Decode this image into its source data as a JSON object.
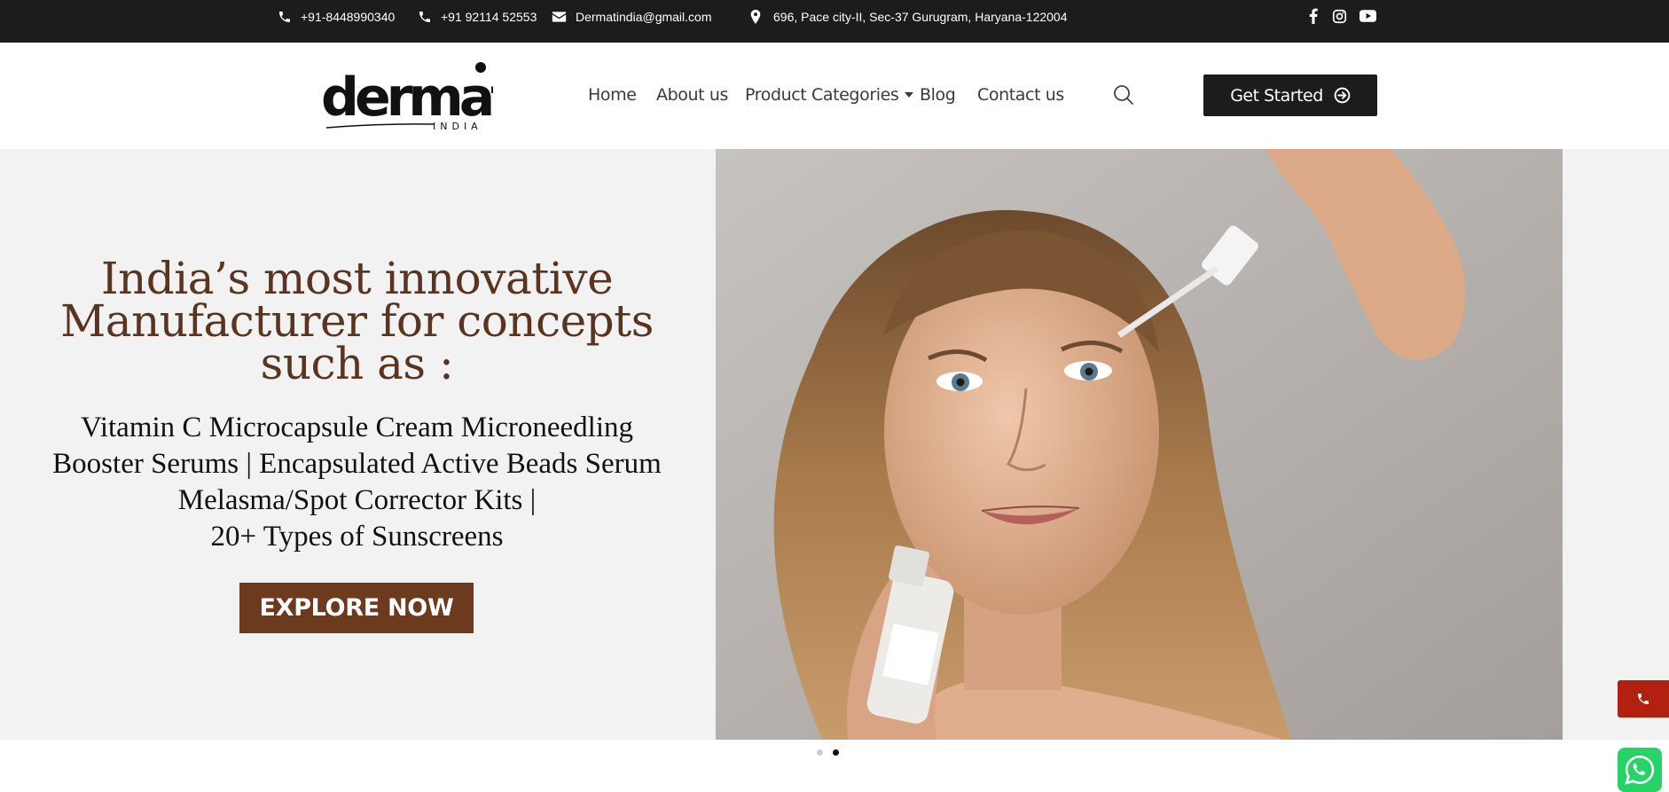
{
  "topbar": {
    "phone1": "+91-8448990340",
    "phone2": "+91 92114 52553",
    "email": "Dermatindia@gmail.com",
    "address": "696, Pace city-II, Sec-37 Gurugram, Haryana-122004",
    "social": [
      "facebook-icon",
      "instagram-icon",
      "youtube-icon"
    ]
  },
  "header": {
    "logo_word": "dermat",
    "logo_sub": "INDIA",
    "nav": {
      "home": "Home",
      "about": "About us",
      "categories": "Product Categories",
      "blog": "Blog",
      "contact": "Contact us"
    },
    "cta": "Get Started"
  },
  "hero": {
    "heading_lines": [
      "India’s most innovative",
      "Manufacturer for concepts",
      "such as :"
    ],
    "sub_lines": [
      "Vitamin C Microcapsule Cream Microneedling",
      "Booster Serums | Encapsulated Active Beads Serum",
      "Melasma/Spot Corrector Kits  |",
      "20+ Types of Sunscreens"
    ],
    "button": "EXPLORE NOW",
    "slide_count": 2,
    "active_slide": 2
  },
  "colors": {
    "topbar_bg": "#1c1c1c",
    "heading": "#5a3420",
    "button_bg": "#6b3a1f",
    "call_fab": "#b2200f",
    "whatsapp": "#25d366"
  }
}
